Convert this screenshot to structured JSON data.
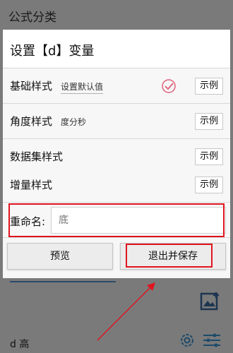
{
  "background": {
    "header_title": "公式分类",
    "bottom_label": "d 高"
  },
  "dialog": {
    "title": "设置【d】变量",
    "rows": [
      {
        "label": "基础样式",
        "value": "设置默认值",
        "example": "示例"
      },
      {
        "label": "角度样式",
        "value": "度分秒",
        "example": "示例"
      },
      {
        "label": "数据集样式",
        "value": "",
        "example": "示例"
      },
      {
        "label": "增量样式",
        "value": "",
        "example": "示例"
      }
    ],
    "rename": {
      "label": "重命名:",
      "placeholder": "底"
    },
    "buttons": {
      "preview": "预览",
      "save": "退出并保存"
    }
  },
  "colors": {
    "annotation_red": "#e0141e",
    "check_pink": "#e0607a"
  }
}
